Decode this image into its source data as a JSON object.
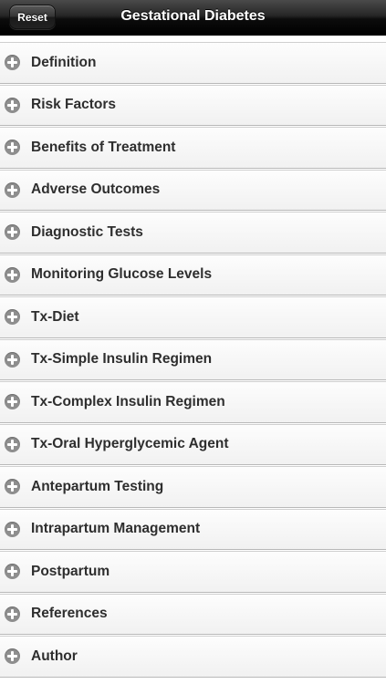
{
  "header": {
    "title": "Gestational Diabetes",
    "reset_label": "Reset"
  },
  "sections": [
    {
      "label": "Definition"
    },
    {
      "label": "Risk Factors"
    },
    {
      "label": "Benefits of Treatment"
    },
    {
      "label": "Adverse Outcomes"
    },
    {
      "label": "Diagnostic Tests"
    },
    {
      "label": "Monitoring Glucose Levels"
    },
    {
      "label": "Tx-Diet"
    },
    {
      "label": "Tx-Simple Insulin Regimen"
    },
    {
      "label": "Tx-Complex Insulin Regimen"
    },
    {
      "label": "Tx-Oral Hyperglycemic Agent"
    },
    {
      "label": "Antepartum Testing"
    },
    {
      "label": "Intrapartum Management"
    },
    {
      "label": "Postpartum"
    },
    {
      "label": "References"
    },
    {
      "label": "Author"
    }
  ],
  "icons": {
    "expand": "plus-circle-icon"
  },
  "colors": {
    "navbar": "#000000",
    "icon": "#8e8e8e",
    "text": "#2e2e2e"
  }
}
